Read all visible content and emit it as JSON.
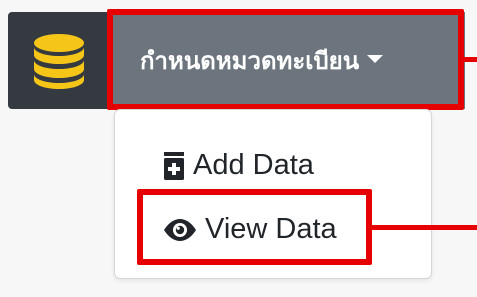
{
  "header": {
    "icon": "database-icon",
    "icon_color": "#f5c518",
    "menu_title": "กำหนดหมวดทะเบียน",
    "menu_caret_icon": "caret-down-icon"
  },
  "dropdown": {
    "items": [
      {
        "label": "Add Data",
        "icon": "file-plus-icon"
      },
      {
        "label": "View Data",
        "icon": "eye-icon"
      }
    ]
  },
  "annotations": {
    "highlight_color": "#e60000"
  }
}
